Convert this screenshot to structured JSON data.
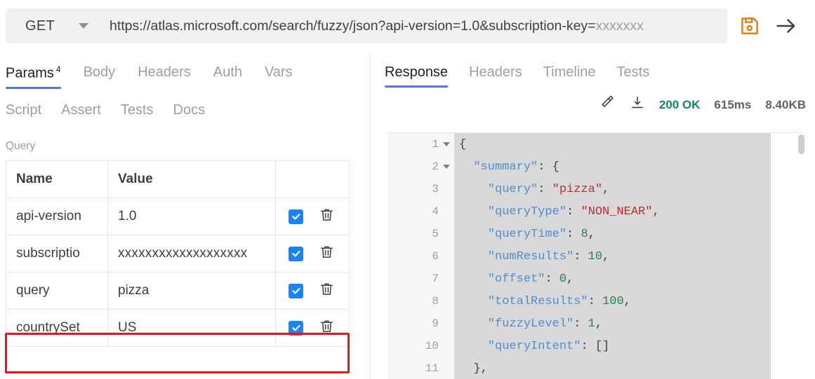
{
  "urlbar": {
    "method": "GET",
    "method_caret_icon": "chevron-down-icon",
    "url_visible": "https://atlas.microsoft.com/search/fuzzy/json?api-version=1.0&subscription-key=",
    "url_masked_suffix": "xxxxxxx",
    "save_icon": "save-floppy-icon",
    "send_icon": "arrow-right-icon",
    "save_icon_color": "#e3790d"
  },
  "request_tabs": {
    "primary": [
      {
        "label": "Params",
        "badge": "4",
        "active": true
      },
      {
        "label": "Body",
        "badge": "",
        "active": false
      },
      {
        "label": "Headers",
        "badge": "",
        "active": false
      },
      {
        "label": "Auth",
        "badge": "",
        "active": false
      },
      {
        "label": "Vars",
        "badge": "",
        "active": false
      }
    ],
    "secondary": [
      {
        "label": "Script",
        "active": false
      },
      {
        "label": "Assert",
        "active": false
      },
      {
        "label": "Tests",
        "active": false
      },
      {
        "label": "Docs",
        "active": false
      }
    ],
    "active_underline_color": "#5872d6"
  },
  "params": {
    "section_label": "Query",
    "columns": [
      "Name",
      "Value",
      ""
    ],
    "rows": [
      {
        "name": "api-version",
        "value": "1.0",
        "masked": false,
        "enabled": true,
        "highlighted": false
      },
      {
        "name": "subscriptio",
        "value": "xxxxxxxxxxxxxxxxxxx",
        "masked": true,
        "enabled": true,
        "highlighted": false
      },
      {
        "name": "query",
        "value": "pizza",
        "masked": false,
        "enabled": true,
        "highlighted": false
      },
      {
        "name": "countrySet",
        "value": "US",
        "masked": false,
        "enabled": true,
        "highlighted": true
      }
    ],
    "checkbox_color": "#1a83f7",
    "delete_icon": "trash-icon",
    "highlight_color": "#e8161b"
  },
  "response_tabs": [
    {
      "label": "Response",
      "active": true
    },
    {
      "label": "Headers",
      "active": false
    },
    {
      "label": "Timeline",
      "active": false
    },
    {
      "label": "Tests",
      "active": false
    }
  ],
  "response_meta": {
    "clear_icon": "eraser-icon",
    "download_icon": "download-icon",
    "status": "200 OK",
    "status_color": "#0f8a62",
    "time": "615ms",
    "size": "8.40KB"
  },
  "response_body": {
    "lines": [
      {
        "num": "1",
        "foldable": true,
        "tokens": [
          {
            "t": "{",
            "c": "p"
          }
        ]
      },
      {
        "num": "2",
        "foldable": true,
        "tokens": [
          {
            "t": "  \"summary\"",
            "c": "k"
          },
          {
            "t": ": {",
            "c": "p"
          }
        ]
      },
      {
        "num": "3",
        "foldable": false,
        "tokens": [
          {
            "t": "    \"query\"",
            "c": "k"
          },
          {
            "t": ": ",
            "c": "p"
          },
          {
            "t": "\"pizza\"",
            "c": "s"
          },
          {
            "t": ",",
            "c": "p"
          }
        ]
      },
      {
        "num": "4",
        "foldable": false,
        "tokens": [
          {
            "t": "    \"queryType\"",
            "c": "k"
          },
          {
            "t": ": ",
            "c": "p"
          },
          {
            "t": "\"NON_NEAR\"",
            "c": "s"
          },
          {
            "t": ",",
            "c": "p"
          }
        ]
      },
      {
        "num": "5",
        "foldable": false,
        "tokens": [
          {
            "t": "    \"queryTime\"",
            "c": "k"
          },
          {
            "t": ": ",
            "c": "p"
          },
          {
            "t": "8",
            "c": "n"
          },
          {
            "t": ",",
            "c": "p"
          }
        ]
      },
      {
        "num": "6",
        "foldable": false,
        "tokens": [
          {
            "t": "    \"numResults\"",
            "c": "k"
          },
          {
            "t": ": ",
            "c": "p"
          },
          {
            "t": "10",
            "c": "n"
          },
          {
            "t": ",",
            "c": "p"
          }
        ]
      },
      {
        "num": "7",
        "foldable": false,
        "tokens": [
          {
            "t": "    \"offset\"",
            "c": "k"
          },
          {
            "t": ": ",
            "c": "p"
          },
          {
            "t": "0",
            "c": "n"
          },
          {
            "t": ",",
            "c": "p"
          }
        ]
      },
      {
        "num": "8",
        "foldable": false,
        "tokens": [
          {
            "t": "    \"totalResults\"",
            "c": "k"
          },
          {
            "t": ": ",
            "c": "p"
          },
          {
            "t": "100",
            "c": "n"
          },
          {
            "t": ",",
            "c": "p"
          }
        ]
      },
      {
        "num": "9",
        "foldable": false,
        "tokens": [
          {
            "t": "    \"fuzzyLevel\"",
            "c": "k"
          },
          {
            "t": ": ",
            "c": "p"
          },
          {
            "t": "1",
            "c": "n"
          },
          {
            "t": ",",
            "c": "p"
          }
        ]
      },
      {
        "num": "10",
        "foldable": false,
        "tokens": [
          {
            "t": "    \"queryIntent\"",
            "c": "k"
          },
          {
            "t": ": []",
            "c": "p"
          }
        ]
      },
      {
        "num": "11",
        "foldable": false,
        "tokens": [
          {
            "t": "  },",
            "c": "p"
          }
        ]
      }
    ]
  }
}
